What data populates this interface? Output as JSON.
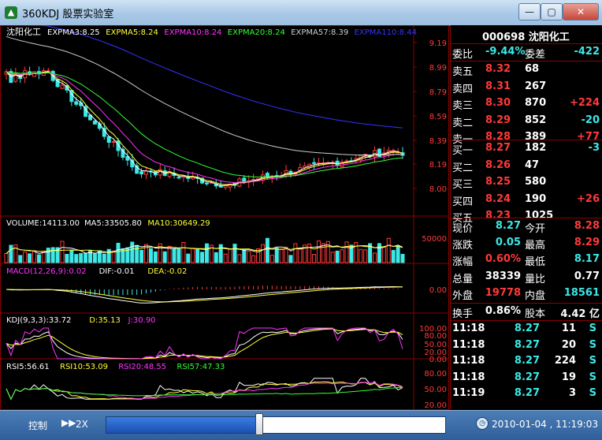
{
  "window": {
    "title": "360KDJ 股票实验室",
    "app_icon": "stock-app-icon",
    "min_glyph": "—",
    "max_glyph": "▢",
    "close_glyph": "✕"
  },
  "colors": {
    "up": "#ff3a3a",
    "down": "#3ce8e8",
    "expma3": "#ffffff",
    "expma5": "#ffff33",
    "expma10": "#ff33ff",
    "expma20": "#33ff33",
    "expma57": "#cccccc",
    "expma110": "#3333ff"
  },
  "price_panel": {
    "stock_name": "沈阳化工",
    "indicators": [
      {
        "label": "EXPMA3:8.25",
        "color": "#ffffff"
      },
      {
        "label": "EXPMA5:8.24",
        "color": "#ffff33"
      },
      {
        "label": "EXPMA10:8.24",
        "color": "#ff33ff"
      },
      {
        "label": "EXPMA20:8.24",
        "color": "#33ff33"
      },
      {
        "label": "EXPMA57:8.39",
        "color": "#cccccc"
      },
      {
        "label": "EXPMA110:8.44",
        "color": "#3333ff"
      }
    ],
    "y_ticks": [
      "9.19",
      "8.99",
      "8.79",
      "8.59",
      "8.39",
      "8.19",
      "8.00"
    ]
  },
  "volume_panel": {
    "labels": [
      {
        "label": "VOLUME:14113.00",
        "color": "#ffffff"
      },
      {
        "label": "MA5:33505.80",
        "color": "#ffffff"
      },
      {
        "label": "MA10:30649.29",
        "color": "#ffff33"
      }
    ],
    "y_ticks": [
      "50000"
    ]
  },
  "macd_panel": {
    "labels": [
      {
        "label": "MACD(12,26,9):0.02",
        "color": "#ff33ff"
      },
      {
        "label": "DIF:-0.01",
        "color": "#ffffff"
      },
      {
        "label": "DEA:-0.02",
        "color": "#ffff33"
      }
    ],
    "y_ticks": [
      "0.00"
    ]
  },
  "kdj_panel": {
    "labels": [
      {
        "label": "KDJ(9,3,3):33.72",
        "color": "#ffffff"
      },
      {
        "label": "D:35.13",
        "color": "#ffff33"
      },
      {
        "label": "J:30.90",
        "color": "#ff33ff"
      }
    ],
    "y_ticks": [
      "100.00",
      "80.00",
      "50.00",
      "20.00",
      "0.00"
    ]
  },
  "rsi_panel": {
    "labels": [
      {
        "label": "RSI5:56.61",
        "color": "#ffffff"
      },
      {
        "label": "RSI10:53.09",
        "color": "#ffff33"
      },
      {
        "label": "RSI20:48.55",
        "color": "#ff33ff"
      },
      {
        "label": "RSI57:47.33",
        "color": "#33ff33"
      }
    ],
    "y_ticks": [
      "80.00",
      "50.00",
      "20.00"
    ]
  },
  "quote": {
    "header": "000698 沈阳化工",
    "weibi": {
      "label": "委比",
      "value": "-9.44%",
      "label2": "委差",
      "value2": "-422"
    },
    "asks": [
      {
        "label": "卖五",
        "price": "8.32",
        "volume": "68",
        "change": ""
      },
      {
        "label": "卖四",
        "price": "8.31",
        "volume": "267",
        "change": ""
      },
      {
        "label": "卖三",
        "price": "8.30",
        "volume": "870",
        "change": "+224"
      },
      {
        "label": "卖二",
        "price": "8.29",
        "volume": "852",
        "change": "-20"
      },
      {
        "label": "卖一",
        "price": "8.28",
        "volume": "389",
        "change": "+77"
      }
    ],
    "bids": [
      {
        "label": "买一",
        "price": "8.27",
        "volume": "182",
        "change": "-3"
      },
      {
        "label": "买二",
        "price": "8.26",
        "volume": "47",
        "change": ""
      },
      {
        "label": "买三",
        "price": "8.25",
        "volume": "580",
        "change": ""
      },
      {
        "label": "买四",
        "price": "8.24",
        "volume": "190",
        "change": "+26"
      },
      {
        "label": "买五",
        "price": "8.23",
        "volume": "1025",
        "change": ""
      }
    ],
    "stats": [
      {
        "l1": "现价",
        "v1": "8.27",
        "c1": "green",
        "l2": "今开",
        "v2": "8.28",
        "c2": "red"
      },
      {
        "l1": "涨跌",
        "v1": "0.05",
        "c1": "green",
        "l2": "最高",
        "v2": "8.29",
        "c2": "red"
      },
      {
        "l1": "涨幅",
        "v1": "0.60%",
        "c1": "red",
        "l2": "最低",
        "v2": "8.17",
        "c2": "green"
      },
      {
        "l1": "总量",
        "v1": "38339",
        "c1": "white",
        "l2": "量比",
        "v2": "0.77",
        "c2": "white"
      },
      {
        "l1": "外盘",
        "v1": "19778",
        "c1": "red",
        "l2": "内盘",
        "v2": "18561",
        "c2": "green"
      }
    ],
    "turnover": {
      "label": "换手",
      "value": "0.86%",
      "label2": "股本",
      "value2": "4.42 亿"
    },
    "ticks": [
      {
        "time": "11:18",
        "price": "8.27",
        "volume": "11",
        "side": "S"
      },
      {
        "time": "11:18",
        "price": "8.27",
        "volume": "20",
        "side": "S"
      },
      {
        "time": "11:18",
        "price": "8.27",
        "volume": "224",
        "side": "S"
      },
      {
        "time": "11:18",
        "price": "8.27",
        "volume": "19",
        "side": "S"
      },
      {
        "time": "11:19",
        "price": "8.27",
        "volume": "3",
        "side": "S"
      }
    ]
  },
  "playback": {
    "control_label": "控制",
    "speed_icon": "fast-forward-icon",
    "speed_label": "2X",
    "progress": 0.46,
    "clock_icon": "clock-icon",
    "datetime": "2010-01-04 , 11:19:03"
  }
}
